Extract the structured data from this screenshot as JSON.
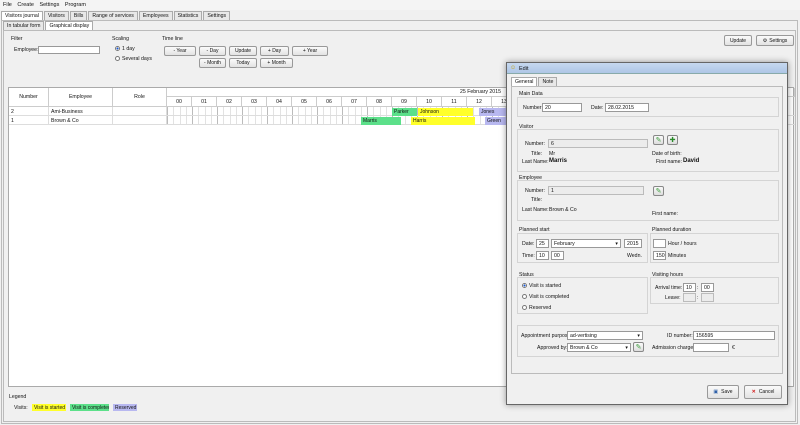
{
  "menu": [
    "File",
    "Create",
    "Settings",
    "Program"
  ],
  "main_tabs": [
    "Visitors journal",
    "Visitors",
    "Bills",
    "Range of services",
    "Employees",
    "Statistics",
    "Settings"
  ],
  "sub_tabs": [
    "In tabular form",
    "Graphical display"
  ],
  "filter": {
    "title": "Filter",
    "employee_label": "Employee:",
    "employee_value": ""
  },
  "scaling": {
    "title": "Scaling",
    "opt1": "1 day",
    "opt2": "Several days"
  },
  "timeline": {
    "title": "Time line",
    "row1": [
      "- Year",
      "- Day",
      "Update",
      "+ Day",
      "+ Year"
    ],
    "row2": [
      "- Month",
      "Today",
      "+ Month"
    ]
  },
  "top_buttons": {
    "update": "Update",
    "settings": "Settings"
  },
  "grid": {
    "col_number": "Number",
    "col_employee": "Employee",
    "col_role": "Role",
    "date": "25 February 2015",
    "hours": [
      "00",
      "01",
      "02",
      "03",
      "04",
      "05",
      "06",
      "07",
      "08",
      "09",
      "10",
      "11",
      "12",
      "13"
    ],
    "rows": [
      {
        "number": "2",
        "employee": "Ami-Business",
        "role": ""
      },
      {
        "number": "1",
        "employee": "Brown & Co",
        "role": ""
      }
    ],
    "bars": [
      {
        "label": "Parker",
        "row": 0,
        "color": "#5ce08a"
      },
      {
        "label": "Johnson",
        "row": 0,
        "color": "#ffff2a"
      },
      {
        "label": "Jones",
        "row": 0,
        "color": "#b8b8f0"
      },
      {
        "label": "Marris",
        "row": 1,
        "color": "#5ce08a"
      },
      {
        "label": "Harris",
        "row": 1,
        "color": "#ffff2a"
      },
      {
        "label": "Green",
        "row": 1,
        "color": "#b8b8f0"
      }
    ]
  },
  "legend": {
    "title": "Legend",
    "visits_label": "Visits:",
    "items": [
      {
        "label": "Visit is started",
        "color": "#ffff2a"
      },
      {
        "label": "Visit is completed",
        "color": "#5ce08a"
      },
      {
        "label": "Reserved",
        "color": "#b8b8f0"
      }
    ]
  },
  "dialog": {
    "title": "Edit",
    "tabs": [
      "General",
      "Note"
    ],
    "main_data": {
      "title": "Main Data",
      "number_label": "Number:",
      "number": "20",
      "date_label": "Date:",
      "date": "28.02.2015"
    },
    "visitor": {
      "title": "Visitor",
      "number_label": "Number:",
      "number": "6",
      "title_label": "Title:",
      "title_value": "Mr",
      "dob_label": "Date of birth:",
      "last_name_label": "Last Name:",
      "last_name": "Marris",
      "first_name_label": "First name:",
      "first_name": "David"
    },
    "employee": {
      "title": "Employee",
      "number_label": "Number:",
      "number": "1",
      "title_label": "Title:",
      "last_name_label": "Last Name:",
      "last_name": "Brown & Co",
      "first_name_label": "First name:"
    },
    "planned_start": {
      "title": "Planned start",
      "date_label": "Date:",
      "day": "25",
      "month": "February",
      "year": "2015",
      "time_label": "Time:",
      "hour": "10",
      "minute": "00",
      "weekday": "Wedn."
    },
    "planned_duration": {
      "title": "Planned duration",
      "hours_label": "Hour / hours",
      "minutes_value": "150",
      "minutes_label": "Minutes"
    },
    "status": {
      "title": "Status",
      "options": [
        "Visit is started",
        "Visit is completed",
        "Reserved"
      ],
      "selected": 0
    },
    "visiting_hours": {
      "title": "Visiting hours",
      "arrival_label": "Arrival time:",
      "arrival_h": "10",
      "arrival_m": "00",
      "leave_label": "Leave:"
    },
    "appointment": {
      "purpose_label": "Appointment purpose:",
      "purpose": "ad-vertising",
      "approved_label": "Approved by:",
      "approved": "Brown & Co",
      "id_label": "ID number:",
      "id": "156595",
      "charge_label": "Admission charge:",
      "currency": "€"
    },
    "save": "Save",
    "cancel": "Cancel"
  }
}
